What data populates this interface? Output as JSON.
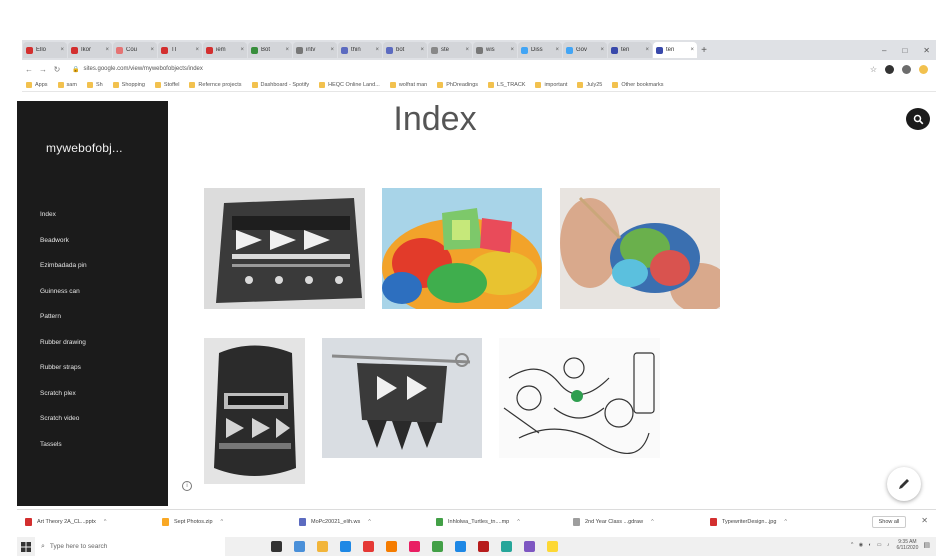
{
  "browser": {
    "tabs": [
      {
        "label": "Ello",
        "color": "#d32f2f"
      },
      {
        "label": "Ikor",
        "color": "#d32f2f"
      },
      {
        "label": "Cou",
        "color": "#e57373"
      },
      {
        "label": "TI",
        "color": "#d32f2f"
      },
      {
        "label": "iem",
        "color": "#d32f2f"
      },
      {
        "label": "Bot",
        "color": "#388e3c"
      },
      {
        "label": "intv",
        "color": "#777777"
      },
      {
        "label": "thin",
        "color": "#5c6bc0"
      },
      {
        "label": "bot",
        "color": "#5c6bc0"
      },
      {
        "label": "ste",
        "color": "#888888"
      },
      {
        "label": "wis",
        "color": "#777777"
      },
      {
        "label": "Diss",
        "color": "#42a5f5"
      },
      {
        "label": "Gov",
        "color": "#42a5f5"
      },
      {
        "label": "ten",
        "color": "#3949ab"
      },
      {
        "label": "ten",
        "color": "#3949ab",
        "active": true
      }
    ],
    "new_tab": "+",
    "window_controls": [
      "–",
      "□",
      "✕"
    ],
    "url": "sites.google.com/view/mywebofobjects/index",
    "bookmarks": [
      "Apps",
      "sam",
      "Sh",
      "Shopping",
      "Stoffel",
      "Refernce projects",
      "Dashboard - Spotify",
      "HEQC Online Land...",
      "wolfrat man",
      "PhDreadings",
      "LS_TRACK",
      "important",
      "July25",
      "Other bookmarks"
    ]
  },
  "site": {
    "name": "mywebofobj...",
    "nav": [
      "Index",
      "Beadwork",
      "Ezimbadada pin",
      "Guinness can",
      "Pattern",
      "Rubber drawing",
      "Rubber straps",
      "Scratch plex",
      "Scratch video",
      "Tassels"
    ]
  },
  "page": {
    "title": "Index",
    "info_icon": "i"
  },
  "downloads": {
    "items": [
      {
        "label": "Art Theory 2A_CL...pptx",
        "color": "#d32f2f"
      },
      {
        "label": "Sept Photos.zip",
        "color": "#f9a825"
      },
      {
        "label": "MoPc20021_elih.ws",
        "color": "#5c6bc0"
      },
      {
        "label": "Inhlolwa_Turtles_tn....mp",
        "color": "#43a047"
      },
      {
        "label": "2nd Year Class ...gdraw",
        "color": "#9e9e9e"
      },
      {
        "label": "TypewriterDesign...jpg",
        "color": "#d32f2f"
      }
    ],
    "show_all": "Show all",
    "close": "✕"
  },
  "taskbar": {
    "search_placeholder": "Type here to search",
    "time": "9:35 AM",
    "date": "6/11/2020",
    "apps": [
      "#333333",
      "#4a90d9",
      "#f2b53a",
      "#1e88e5",
      "#e53935",
      "#f57c00",
      "#e91e63",
      "#43a047",
      "#1e88e5",
      "#b71c1c",
      "#26a69a",
      "#7e57c2",
      "#fdd835"
    ]
  }
}
